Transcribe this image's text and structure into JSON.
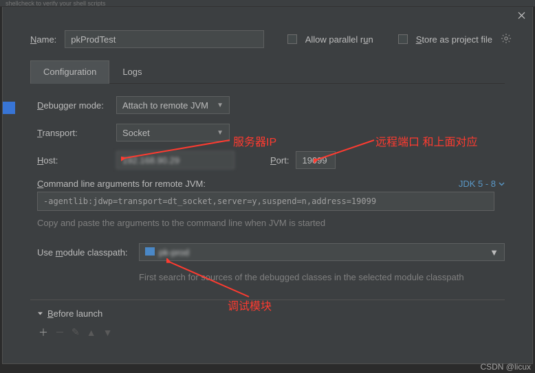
{
  "hint_bar": " shellcheck to verify your shell scripts",
  "top": {
    "name_label": "Name:",
    "name_value": "pkProdTest",
    "allow_parallel": "Allow parallel run",
    "store_project": "Store as project file"
  },
  "tabs": {
    "configuration": "Configuration",
    "logs": "Logs"
  },
  "config": {
    "debugger_mode_label": "Debugger mode:",
    "debugger_mode_value": "Attach to remote JVM",
    "transport_label": "Transport:",
    "transport_value": "Socket",
    "host_label": "Host:",
    "host_value": "192.168.90.29",
    "port_label": "Port:",
    "port_value": "19099",
    "cmdline_label": "Command line arguments for remote JVM:",
    "jdk_version": "JDK 5 - 8",
    "cmdline_value": "-agentlib:jdwp=transport=dt_socket,server=y,suspend=n,address=19099",
    "cmdline_help": "Copy and paste the arguments to the command line when JVM is started",
    "module_label": "Use module classpath:",
    "module_value": "pk-prod",
    "module_help": "First search for sources of the debugged classes in the selected module classpath"
  },
  "before_launch": {
    "title": "Before launch"
  },
  "annotations": {
    "server_ip": "服务器IP",
    "remote_port": "远程端口  和上面对应",
    "debug_module": "调试模块"
  },
  "watermark": "CSDN @licux"
}
